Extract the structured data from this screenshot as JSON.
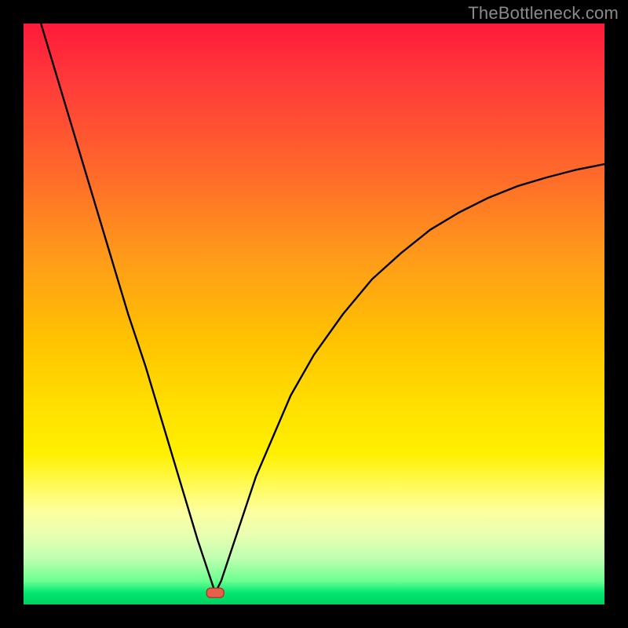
{
  "watermark": "TheBottleneck.com",
  "colors": {
    "frame_bg": "#000000",
    "gradient_top": "#ff1a3a",
    "gradient_bottom": "#00d060",
    "curve_stroke": "#000000",
    "marker_fill": "#e8604c",
    "marker_stroke": "#a83a2a",
    "watermark": "#8a8a8a"
  },
  "chart_data": {
    "type": "line",
    "title": "",
    "xlabel": "",
    "ylabel": "",
    "xlim": [
      0,
      100
    ],
    "ylim": [
      0,
      100
    ],
    "grid": false,
    "legend": null,
    "annotations": [],
    "marker": {
      "x": 33,
      "y": 2
    },
    "series": [
      {
        "name": "curve",
        "x": [
          3,
          6,
          9,
          12,
          15,
          18,
          21,
          24,
          27,
          30,
          31,
          32,
          33,
          34,
          35,
          36,
          38,
          40,
          43,
          46,
          50,
          55,
          60,
          65,
          70,
          75,
          80,
          85,
          90,
          95,
          100
        ],
        "y": [
          100,
          90,
          80,
          70,
          60,
          50,
          41,
          31,
          21,
          11,
          8,
          5,
          2,
          4,
          7,
          10,
          16,
          22,
          29,
          36,
          43,
          50,
          56,
          60.5,
          64.5,
          67.5,
          70,
          72,
          73.5,
          74.8,
          75.8
        ]
      }
    ]
  }
}
